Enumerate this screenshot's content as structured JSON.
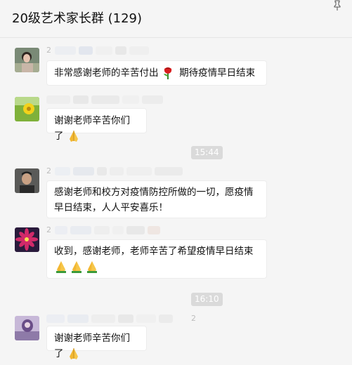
{
  "header": {
    "title": "20级艺术家长群 (129)",
    "pin_icon": "pin-icon"
  },
  "messages": [
    {
      "sender_hint": "2",
      "text": "非常感谢老师的辛苦付出",
      "text2": "期待疫情早日结束",
      "emoji": "rose-icon"
    },
    {
      "sender_hint": "",
      "text": "谢谢老师辛苦你们了",
      "emoji": "praying-hands-icon"
    },
    {
      "sender_hint": "2",
      "line1": "感谢老师和校方对疫情防控所做的一切，愿疫情",
      "line2": "早日结束，人人平安喜乐！"
    },
    {
      "sender_hint": "2",
      "line1": "收到，感谢老师，老师辛苦了希望疫情早日结束",
      "emoji": "praying-hands-icon"
    },
    {
      "sender_hint": "2",
      "text": "谢谢老师辛苦你们了",
      "emoji": "praying-hands-icon"
    }
  ],
  "timestamps": [
    "15:44",
    "16:10"
  ]
}
